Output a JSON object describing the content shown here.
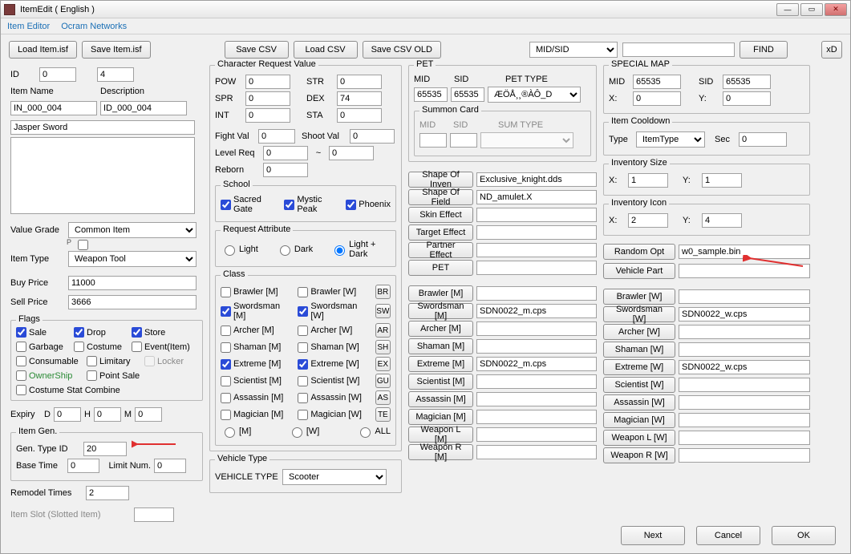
{
  "window": {
    "title": "ItemEdit ( English )"
  },
  "menu": {
    "editor": "Item Editor",
    "ocram": "Ocram Networks"
  },
  "toolbar": {
    "load": "Load Item.isf",
    "save": "Save Item.isf",
    "saveCsv": "Save CSV",
    "loadCsv": "Load CSV",
    "saveCsvOld": "Save CSV OLD",
    "mode": "MID/SID",
    "find": "FIND",
    "xd": "xD"
  },
  "left": {
    "id": "ID",
    "idA": "0",
    "idB": "4",
    "itemName": "Item Name",
    "itemNameVal": "IN_000_004",
    "desc": "Description",
    "descVal": "ID_000_004",
    "longName": "Jasper Sword",
    "pHint": "P",
    "valueGrade": "Value Grade",
    "valueGradeVal": "Common Item",
    "itemType": "Item Type",
    "itemTypeVal": "Weapon Tool",
    "buy": "Buy Price",
    "buyVal": "11000",
    "sell": "Sell Price",
    "sellVal": "3666",
    "flags": "Flags",
    "fl": {
      "sale": "Sale",
      "drop": "Drop",
      "store": "Store",
      "garbage": "Garbage",
      "costume": "Costume",
      "event": "Event(Item)",
      "consumable": "Consumable",
      "limitary": "Limitary",
      "locker": "Locker",
      "ownership": "OwnerShip",
      "pointsale": "Point Sale",
      "cstat": "Costume Stat Combine"
    },
    "expiry": "Expiry",
    "d": "D",
    "h": "H",
    "m": "M",
    "expD": "0",
    "expH": "0",
    "expM": "0",
    "itemGen": "Item Gen.",
    "genType": "Gen. Type ID",
    "genTypeVal": "20",
    "baseTime": "Base Time",
    "baseTimeVal": "0",
    "limitNum": "Limit Num.",
    "limitNumVal": "0",
    "remodel": "Remodel Times",
    "remodelVal": "2",
    "itemSlot": "Item Slot (Slotted Item)"
  },
  "crv": {
    "title": "Character Request Value",
    "pow": "POW",
    "str": "STR",
    "spr": "SPR",
    "dex": "DEX",
    "int": "INT",
    "sta": "STA",
    "powV": "0",
    "strV": "0",
    "sprV": "0",
    "dexV": "74",
    "intV": "0",
    "staV": "0",
    "fight": "Fight Val",
    "fightV": "0",
    "shoot": "Shoot Val",
    "shootV": "0",
    "level": "Level Req",
    "levelV": "0",
    "tilde": "~",
    "levelV2": "0",
    "reborn": "Reborn",
    "rebornV": "0",
    "school": "School",
    "sg": "Sacred Gate",
    "mp": "Mystic Peak",
    "ph": "Phoenix",
    "reqAttr": "Request Attribute",
    "light": "Light",
    "dark": "Dark",
    "ld": "Light + Dark",
    "klass": "Class",
    "cls": [
      {
        "m": "Brawler [M]",
        "w": "Brawler [W]",
        "sq": "BR",
        "cm": false,
        "cw": false
      },
      {
        "m": "Swordsman [M]",
        "w": "Swordsman [W]",
        "sq": "SW",
        "cm": true,
        "cw": true
      },
      {
        "m": "Archer [M]",
        "w": "Archer [W]",
        "sq": "AR",
        "cm": false,
        "cw": false
      },
      {
        "m": "Shaman [M]",
        "w": "Shaman [W]",
        "sq": "SH",
        "cm": false,
        "cw": false
      },
      {
        "m": "Extreme [M]",
        "w": "Extreme [W]",
        "sq": "EX",
        "cm": true,
        "cw": true
      },
      {
        "m": "Scientist [M]",
        "w": "Scientist [W]",
        "sq": "GU",
        "cm": false,
        "cw": false
      },
      {
        "m": "Assassin [M]",
        "w": "Assassin [W]",
        "sq": "AS",
        "cm": false,
        "cw": false
      },
      {
        "m": "Magician [M]",
        "w": "Magician [W]",
        "sq": "TE",
        "cm": false,
        "cw": false
      }
    ],
    "rm": "[M]",
    "rw": "[W]",
    "rall": "ALL",
    "vt": "Vehicle Type",
    "vtl": "VEHICLE TYPE",
    "vtv": "Scooter"
  },
  "pet": {
    "title": "PET",
    "mid": "MID",
    "sid": "SID",
    "ptype": "PET TYPE",
    "midV": "65535",
    "sidV": "65535",
    "ptypeV": "ÆÖÅ¸¸®ÀÔ_D",
    "sc": "Summon Card",
    "scMid": "MID",
    "scSid": "SID",
    "scSum": "SUM TYPE"
  },
  "rbtns": [
    {
      "b": "Shape Of Inven",
      "v": "Exclusive_knight.dds"
    },
    {
      "b": "Shape Of Field",
      "v": "ND_amulet.X"
    },
    {
      "b": "Skin Effect",
      "v": ""
    },
    {
      "b": "Target Effect",
      "v": ""
    },
    {
      "b": "Partner Effect",
      "v": ""
    },
    {
      "b": "PET",
      "v": ""
    }
  ],
  "mbtns": [
    {
      "b": "Brawler [M]",
      "v": ""
    },
    {
      "b": "Swordsman [M]",
      "v": "SDN0022_m.cps"
    },
    {
      "b": "Archer [M]",
      "v": ""
    },
    {
      "b": "Shaman [M]",
      "v": ""
    },
    {
      "b": "Extreme [M]",
      "v": "SDN0022_m.cps"
    },
    {
      "b": "Scientist [M]",
      "v": ""
    },
    {
      "b": "Assassin [M]",
      "v": ""
    },
    {
      "b": "Magician [M]",
      "v": ""
    },
    {
      "b": "Weapon L [M]",
      "v": ""
    },
    {
      "b": "Weapon R [M]",
      "v": ""
    }
  ],
  "smap": {
    "title": "SPECIAL MAP",
    "mid": "MID",
    "sid": "SID",
    "x": "X:",
    "y": "Y:",
    "midV": "65535",
    "sidV": "65535",
    "xV": "0",
    "yV": "0",
    "cd": "Item Cooldown",
    "type": "Type",
    "typeV": "ItemType",
    "sec": "Sec",
    "secV": "0",
    "inv": "Inventory Size",
    "invX": "1",
    "invY": "1",
    "icon": "Inventory Icon",
    "iconX": "2",
    "iconY": "4",
    "randOpt": "Random Opt",
    "randOptV": "w0_sample.bin",
    "vpart": "Vehicle Part"
  },
  "wbtns": [
    {
      "b": "Brawler [W]",
      "v": ""
    },
    {
      "b": "Swordsman [W]",
      "v": "SDN0022_w.cps"
    },
    {
      "b": "Archer [W]",
      "v": ""
    },
    {
      "b": "Shaman [W]",
      "v": ""
    },
    {
      "b": "Extreme [W]",
      "v": "SDN0022_w.cps"
    },
    {
      "b": "Scientist [W]",
      "v": ""
    },
    {
      "b": "Assassin [W]",
      "v": ""
    },
    {
      "b": "Magician [W]",
      "v": ""
    },
    {
      "b": "Weapon L [W]",
      "v": ""
    },
    {
      "b": "Weapon R [W]",
      "v": ""
    }
  ],
  "footer": {
    "next": "Next",
    "cancel": "Cancel",
    "ok": "OK"
  }
}
